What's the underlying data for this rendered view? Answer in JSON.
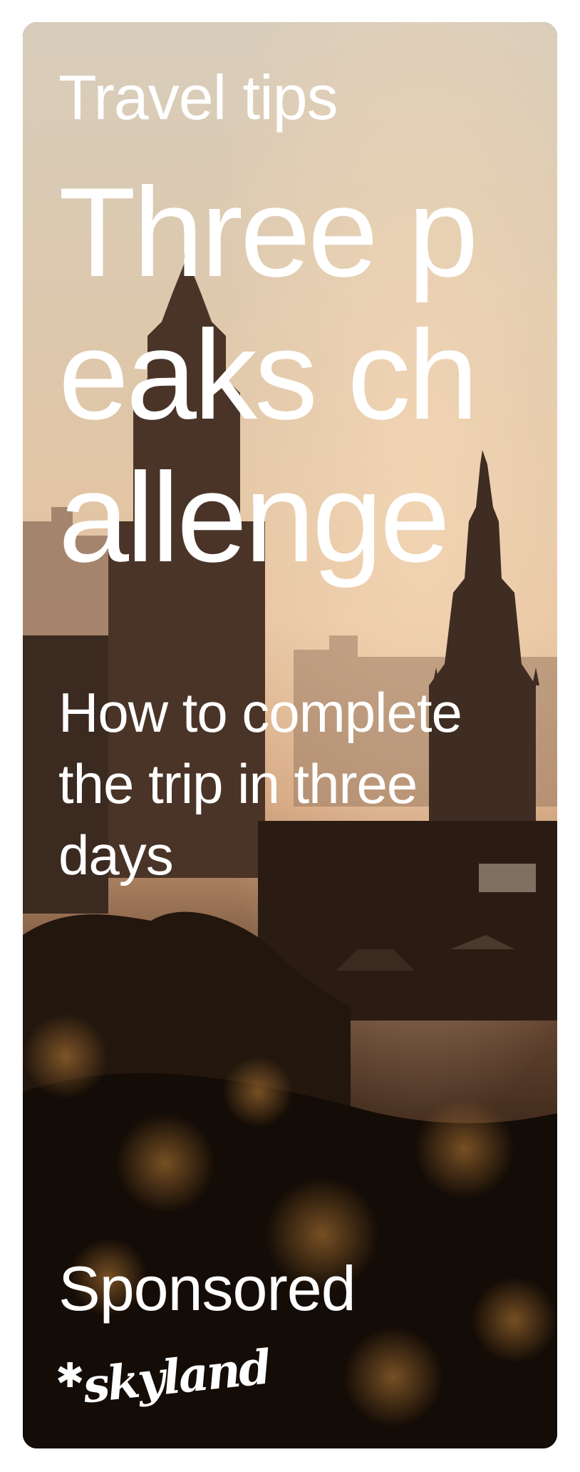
{
  "card": {
    "eyebrow": "Travel tips",
    "headline": "Three peaks challenge",
    "subhead": "How to complete the trip in three days",
    "sponsored_label": "Sponsored",
    "brand_logo_text": "skyland",
    "photo_subject": "city-skyline-icon"
  },
  "colors": {
    "text": "#ffffff",
    "sky_top": "#d9c8b0",
    "sky_mid": "#e8c6a2",
    "foreground": "#1a1008"
  }
}
